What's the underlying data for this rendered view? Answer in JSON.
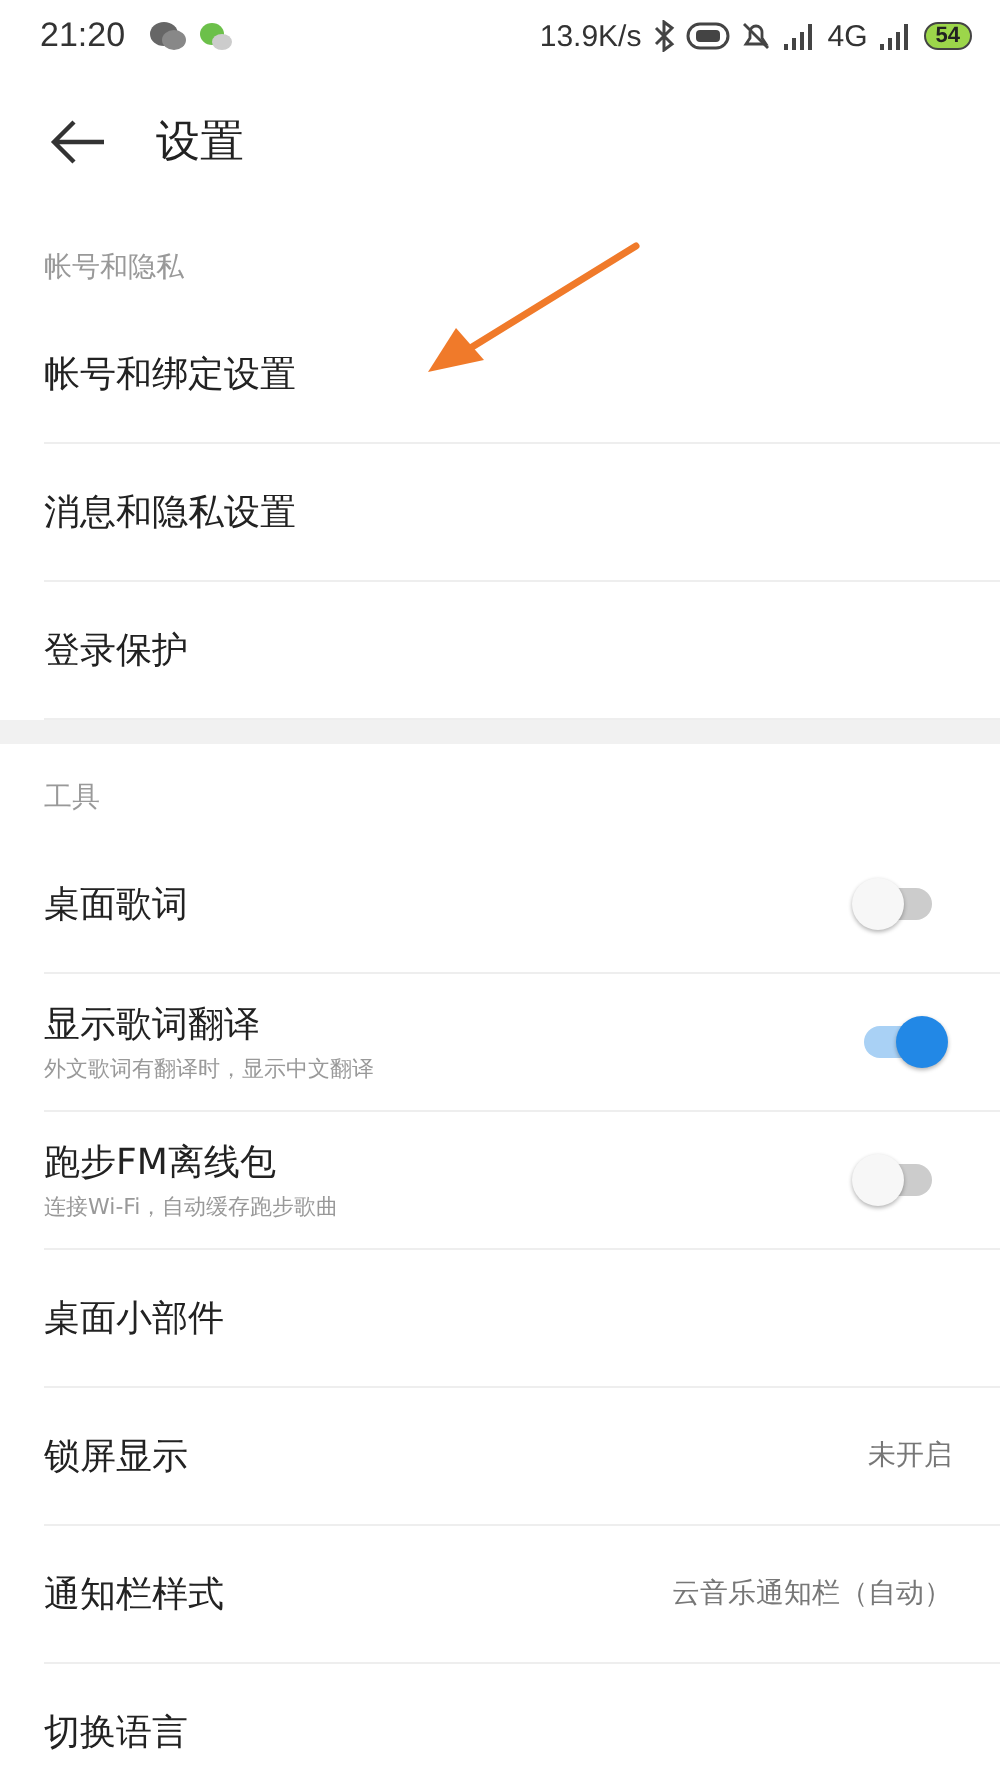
{
  "status_bar": {
    "time": "21:20",
    "speed": "13.9K/s",
    "network": "4G",
    "battery": "54"
  },
  "header": {
    "title": "设置"
  },
  "sections": [
    {
      "title": "帐号和隐私",
      "rows": [
        {
          "kind": "link",
          "label": "帐号和绑定设置"
        },
        {
          "kind": "link",
          "label": "消息和隐私设置"
        },
        {
          "kind": "link",
          "label": "登录保护"
        }
      ]
    },
    {
      "title": "工具",
      "rows": [
        {
          "kind": "switch",
          "label": "桌面歌词",
          "on": false
        },
        {
          "kind": "switch",
          "label": "显示歌词翻译",
          "subtitle": "外文歌词有翻译时，显示中文翻译",
          "on": true
        },
        {
          "kind": "switch",
          "label": "跑步FM离线包",
          "subtitle": "连接Wi-Fi，自动缓存跑步歌曲",
          "on": false
        },
        {
          "kind": "link",
          "label": "桌面小部件"
        },
        {
          "kind": "value",
          "label": "锁屏显示",
          "value": "未开启"
        },
        {
          "kind": "value",
          "label": "通知栏样式",
          "value": "云音乐通知栏（自动）"
        },
        {
          "kind": "link",
          "label": "切换语言"
        }
      ]
    }
  ]
}
